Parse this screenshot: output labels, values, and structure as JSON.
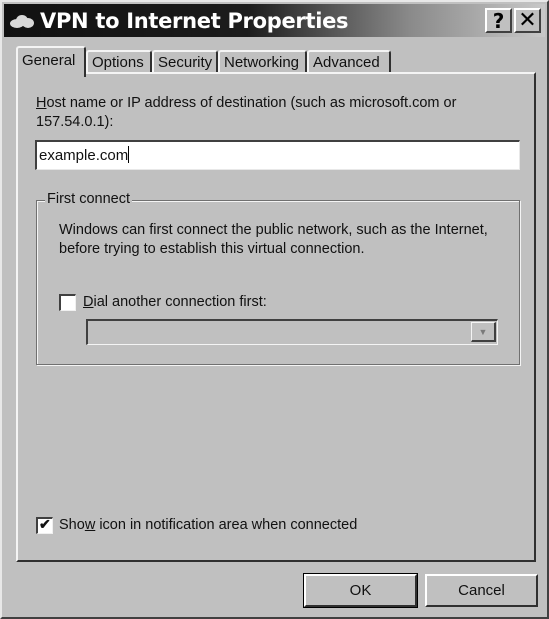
{
  "window": {
    "title": "VPN to Internet Properties",
    "help_label": "?",
    "close_label": "✕"
  },
  "tabs": [
    {
      "label": "General",
      "active": true
    },
    {
      "label": "Options",
      "active": false
    },
    {
      "label": "Security",
      "active": false
    },
    {
      "label": "Networking",
      "active": false
    },
    {
      "label": "Advanced",
      "active": false
    }
  ],
  "general": {
    "host_label_accel": "H",
    "host_label_rest": "ost name or IP address of destination (such as microsoft.com or 157.54.0.1):",
    "host_value": "example.com",
    "first_connect": {
      "legend": "First connect",
      "description": "Windows can first connect the public network, such as the Internet, before trying to establish this virtual connection.",
      "dial_label_accel": "D",
      "dial_label_rest": "ial another connection first:",
      "dial_checked": false,
      "dial_select_value": "",
      "dial_arrow": "▼"
    },
    "show_icon_pre": "Sho",
    "show_icon_accel": "w",
    "show_icon_rest": " icon in notification area when connected",
    "show_icon_checked": true,
    "check_mark": "✔"
  },
  "buttons": {
    "ok": "OK",
    "cancel": "Cancel"
  }
}
